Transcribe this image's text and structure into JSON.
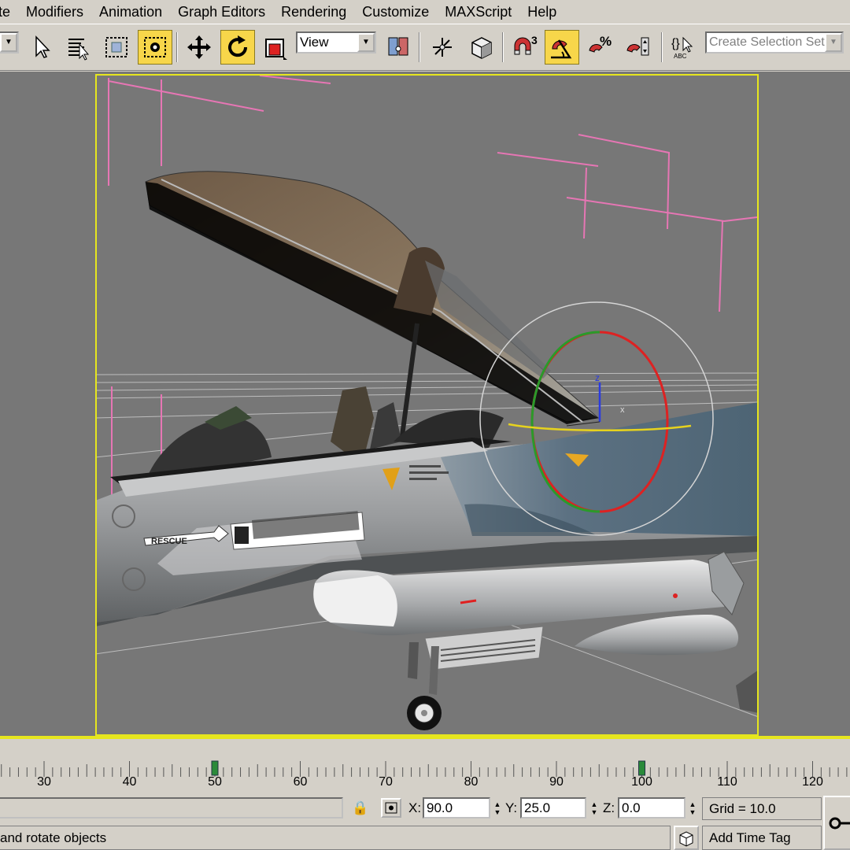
{
  "menu": [
    "te",
    "Modifiers",
    "Animation",
    "Graph Editors",
    "Rendering",
    "Customize",
    "MAXScript",
    "Help"
  ],
  "toolbar": {
    "coord_system": "View",
    "selection_set_placeholder": "Create Selection Set",
    "snap_label": "3",
    "abc_label": "ABC"
  },
  "timeline": {
    "labels": [
      "30",
      "40",
      "50",
      "60",
      "70",
      "80",
      "90",
      "100",
      "110",
      "120"
    ],
    "keys": [
      "50",
      "100"
    ]
  },
  "status": {
    "x_label": "X:",
    "x_value": "90.0",
    "y_label": "Y:",
    "y_value": "25.0",
    "z_label": "Z:",
    "z_value": "0.0",
    "grid": "Grid = 10.0",
    "prompt": "and rotate objects",
    "time_tag": "Add Time Tag"
  },
  "viewport": {
    "decal_text": "RESCUE"
  },
  "colors": {
    "active_button": "#f7d64a",
    "viewport_border": "#e6e61e",
    "viewport_bg": "#777777"
  }
}
